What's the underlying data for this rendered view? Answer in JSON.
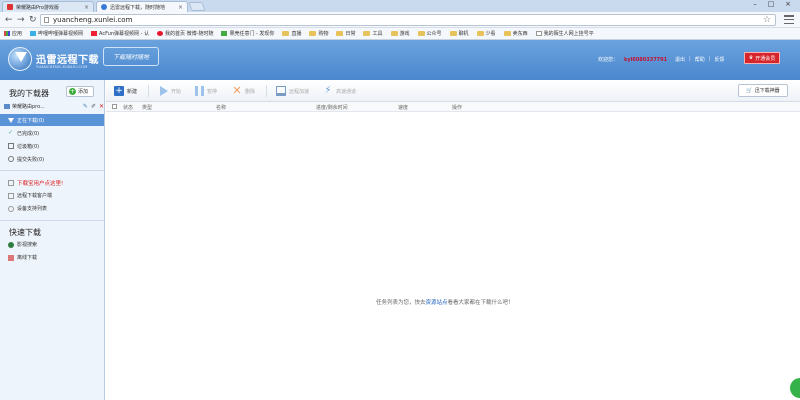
{
  "browser": {
    "tabs": [
      {
        "title": "荣耀路由Pro游戏版",
        "active": false
      },
      {
        "title": "迅雷远程下载，随时随地",
        "active": true
      }
    ],
    "url": "yuancheng.xunlei.com",
    "bookmarks": [
      "应用",
      "哔哩哔哩弹幕视频网",
      "AcFun弹幕视频网 - 认",
      "我的首页 微博-随时随",
      "果壳任意门 - 发现你",
      "直播",
      "购物",
      "日常",
      "工具",
      "游戏",
      "公众号",
      "聊机",
      "少看",
      "卖东西",
      "我的陌生人网上挂号平"
    ]
  },
  "header": {
    "brand": "迅雷远程下载",
    "brand_sub": "YUANCHENG.XUNLEI.COM",
    "slogan": "下载随时随地",
    "welcome": "欢迎您：",
    "username": "kyl6080337791",
    "links": [
      "退出",
      "帮助",
      "反馈"
    ],
    "vip_button": "开通会员"
  },
  "sidebar": {
    "title": "我的下载器",
    "add_label": "添加",
    "device": "荣耀路由pro...",
    "items": [
      {
        "label": "正在下载(0)",
        "active": true
      },
      {
        "label": "已完成(0)",
        "active": false
      },
      {
        "label": "垃圾箱(0)",
        "active": false
      },
      {
        "label": "提交失败(0)",
        "active": false
      }
    ],
    "links": [
      {
        "label": "下载宝用户点这里!",
        "red": true
      },
      {
        "label": "远程下载客户端",
        "red": false
      },
      {
        "label": "设备支持列表",
        "red": false
      }
    ],
    "quick_title": "快速下载",
    "quick_items": [
      "影视搜索",
      "离线下载"
    ]
  },
  "toolbar": {
    "buttons": [
      {
        "label": "新建",
        "enabled": true,
        "icon": "plus-icon"
      },
      {
        "label": "开始",
        "enabled": false,
        "icon": "play-icon"
      },
      {
        "label": "暂停",
        "enabled": false,
        "icon": "pause-icon"
      },
      {
        "label": "删除",
        "enabled": false,
        "icon": "delete-icon"
      },
      {
        "label": "远程加速",
        "enabled": false,
        "icon": "monitor-icon"
      },
      {
        "label": "高速通道",
        "enabled": false,
        "icon": "lightning-icon"
      }
    ],
    "tool_button": "迅下载神器"
  },
  "table": {
    "columns": [
      "状态",
      "类型",
      "名称",
      "进度/剩余时间",
      "速度",
      "操作"
    ]
  },
  "empty": {
    "prefix": "任务列表为您，快去",
    "link": "资源站点",
    "suffix": "看看大家都在下载什么吧！"
  },
  "colors": {
    "header_blue": "#4b87cf",
    "active_item": "#5a93d8",
    "vip_red": "#d7262b",
    "username_red": "#c8102e"
  }
}
